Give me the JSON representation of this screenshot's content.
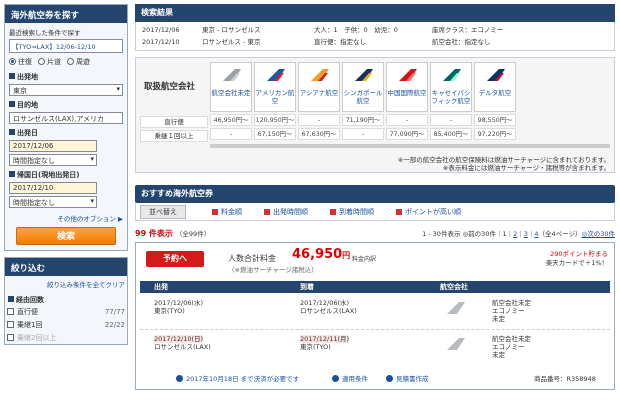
{
  "sidebar": {
    "search_title": "海外航空券を探す",
    "recent_label": "最近検索した条件で探す",
    "recent_link": "【TYO⇒LAX】12/06-12/10",
    "trip_types": [
      {
        "label": "往復",
        "selected": true
      },
      {
        "label": "片道",
        "selected": false
      },
      {
        "label": "周遊",
        "selected": false
      }
    ],
    "origin_label": "出発地",
    "origin_value": "東京",
    "dest_label": "目的地",
    "dest_value": "ロサンゼルス(LAX),アメリカ",
    "dep_date_label": "出発日",
    "dep_date_value": "2017/12/06",
    "dep_time_value": "時間指定なし",
    "ret_date_label": "帰国日(現地出発日)",
    "ret_date_value": "2017/12/10",
    "ret_time_value": "時間指定なし",
    "other_options": "その他のオプション ▶",
    "search_button": "検索",
    "filter_title": "絞り込む",
    "clear_filters": "絞り込み条件を全てクリア",
    "stops_label": "経由回数",
    "stops": [
      {
        "label": "直行便",
        "count": "77/77",
        "dim": false
      },
      {
        "label": "乗継1回",
        "count": "22/22",
        "dim": false
      },
      {
        "label": "乗継2回以上",
        "count": "",
        "dim": true
      }
    ]
  },
  "results": {
    "title": "検索結果",
    "rows": [
      {
        "date": "2017/12/06",
        "route": "東京 - ロサンゼルス",
        "pax": "大人：1　子供：0　幼児：0",
        "seat": "座席クラス：エコノミー"
      },
      {
        "date": "2017/12/10",
        "route": "ロサンゼルス - 東京",
        "pax": "直行便：指定なし",
        "seat": "航空会社：指定なし"
      }
    ]
  },
  "airlines": {
    "label": "取扱航空会社",
    "row_direct": "直行便",
    "row_transfer": "乗継１回以上",
    "list": [
      {
        "name": "航空会社未定",
        "direct": "46,950円〜",
        "transfer": "-",
        "logo": "gray-tail-icon",
        "c1": "#9aa0a6",
        "c2": "#c8cbd0"
      },
      {
        "name": "アメリカン航空",
        "direct": "120,950円〜",
        "transfer": "67,150円〜",
        "logo": "american-airlines-logo-icon",
        "c1": "#1b56a6",
        "c2": "#d22"
      },
      {
        "name": "アシアナ航空",
        "direct": "-",
        "transfer": "67,630円〜",
        "logo": "asiana-logo-icon",
        "c1": "#f0a020",
        "c2": "#c22"
      },
      {
        "name": "シンガポール航空",
        "direct": "71,190円〜",
        "transfer": "-",
        "logo": "singapore-airlines-logo-icon",
        "c1": "#1a2f6a",
        "c2": "#e9b100"
      },
      {
        "name": "中国国際航空",
        "direct": "-",
        "transfer": "77,090円〜",
        "logo": "air-china-logo-icon",
        "c1": "#d1141a",
        "c2": "#ff6b6b"
      },
      {
        "name": "キャセイパシフィック航空",
        "direct": "-",
        "transfer": "85,400円〜",
        "logo": "cathay-pacific-logo-icon",
        "c1": "#006564",
        "c2": "#8fd"
      },
      {
        "name": "デルタ航空",
        "direct": "98,550円〜",
        "transfer": "97,220円〜",
        "logo": "delta-logo-icon",
        "c1": "#003366",
        "c2": "#d2002a"
      }
    ],
    "note1": "※一部の航空会社の航空保険料は燃油サーチャージに含まれております。",
    "note2": "※表示料金には燃油サーチャージ・諸税等が含まれます。"
  },
  "recommended": {
    "title": "おすすめ海外航空券",
    "sort_label": "並べ替え",
    "tabs": [
      "料金順",
      "出発時間順",
      "到着時間順",
      "ポイントが高い順"
    ],
    "count": "99 件表示",
    "total": "（全99件）",
    "pager_text": "1 - 30件表示 ◎前の30件｜",
    "pages": [
      "1",
      "2",
      "3",
      "4"
    ],
    "pager_mid": "（全4ページ）",
    "pager_next": "◎次の30件"
  },
  "offer": {
    "book_button": "予約へ",
    "fare_label": "人数合計料金",
    "fare_value": "46,950",
    "fare_unit": "円",
    "fare_note": "料金内訳",
    "fare_sub": "（※燃油サーチャージ諸税込）",
    "point1": "290ポイント貯まる",
    "point2": "楽天カードで＋1%！",
    "head_dep": "出発",
    "head_arr": "到着",
    "head_air": "航空会社",
    "segments": [
      {
        "dep_date": "2017/12/06(水)",
        "dep_place": "東京(TYO)",
        "arr_date": "2017/12/06(水)",
        "arr_place": "ロサンゼルス(LAX)",
        "air1": "航空会社未定",
        "air2": "エコノミー",
        "air3": "未定",
        "highlight": false
      },
      {
        "dep_date": "2017/12/10(日)",
        "dep_place": "ロサンゼルス(LAX)",
        "arr_date": "2017/12/11(月)",
        "arr_place": "東京(TYO)",
        "air1": "航空会社未定",
        "air2": "エコノミー",
        "air3": "未定",
        "highlight": true
      }
    ],
    "deadline": "2017年10月18日 まで決済が必要です",
    "rules": "適用条件",
    "quote": "見積書作成",
    "product_no": "商品番号：R358948"
  },
  "colors": {
    "navy": "#24466e",
    "accent_red": "#d41a1a",
    "orange": "#f07c00",
    "link": "#1a4fa0"
  }
}
